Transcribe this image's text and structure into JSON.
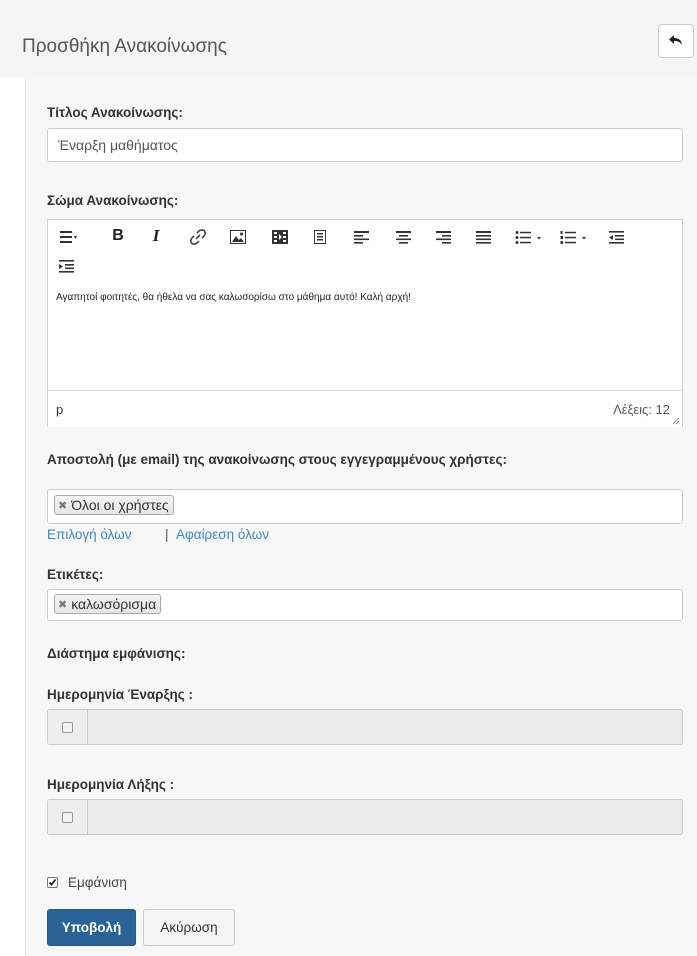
{
  "header": {
    "title": "Προσθήκη Ανακοίνωσης",
    "back_icon": "reply-arrow-icon"
  },
  "form": {
    "title_label": "Τίτλος Ανακοίνωσης:",
    "title_value": "Έναρξη μαθήματος",
    "body_label": "Σώμα Ανακοίνωσης:",
    "editor": {
      "toolbar_icons": [
        "format-icon",
        "bold-icon",
        "italic-icon",
        "link-icon",
        "image-icon",
        "media-icon",
        "file-icon",
        "align-left-icon",
        "align-center-icon",
        "align-right-icon",
        "align-justify-icon",
        "bullet-list-icon",
        "numbered-list-icon",
        "outdent-icon",
        "indent-icon"
      ],
      "bold_glyph": "B",
      "italic_glyph": "I",
      "content": "Αγαπητοί φοιτητές, θα ήθελα να σας καλωσορίσω στο μάθημα αυτό! Καλή αρχή!",
      "path": "p",
      "word_count": "Λέξεις: 12"
    },
    "recipients_label": "Αποστολή (με email) της ανακοίνωσης στους εγγεγραμμένους χρήστες:",
    "recipients_tag": "Όλοι οι χρήστες",
    "select_all": "Επιλογή όλων",
    "separator": "|",
    "remove_all": "Αφαίρεση όλων",
    "tags_label": "Ετικέτες:",
    "tag_value": "καλωσόρισμα",
    "display_interval_label": "Διάστημα εμφάνισης:",
    "start_date_label": "Ημερομηνία Έναρξης :",
    "end_date_label": "Ημερομηνία Λήξης :",
    "start_date_enabled": false,
    "end_date_enabled": false,
    "visible_label": "Εμφάνιση",
    "visible_checked": true,
    "submit": "Υποβολή",
    "cancel": "Ακύρωση"
  },
  "colors": {
    "primary": "#2a6496",
    "link": "#3a87c5",
    "panel": "#f7f7f7"
  }
}
